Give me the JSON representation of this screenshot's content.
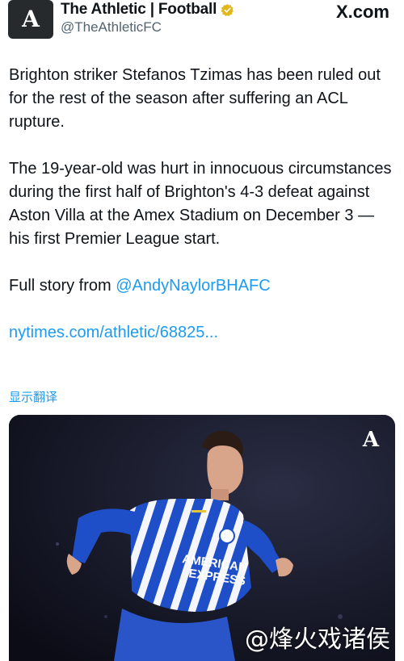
{
  "tweet": {
    "author": {
      "display_name": "The Athletic | Football",
      "handle": "@TheAthleticFC",
      "avatar_letter": "A",
      "verified_color": "#e2b719"
    },
    "site_badge": "X.com",
    "paragraphs": [
      "Brighton striker Stefanos Tzimas has been ruled out for the rest of the season after suffering an ACL rupture.",
      "The 19-year-old was hurt in innocuous circumstances during the first half of Brighton's 4-3 defeat against Aston Villa at the Amex Stadium on December 3 — his first Premier League start."
    ],
    "full_story_prefix": "Full story from ",
    "mention": "@AndyNaylorBHAFC",
    "link": "nytimes.com/athletic/68825...",
    "translate_label": "显示翻译",
    "media": {
      "logo_letter": "A",
      "jersey_sponsor_line1": "AMERICAN",
      "jersey_sponsor_line2": "EXPRESS",
      "kit_colors": [
        "#1f4fc8",
        "#ffffff"
      ]
    },
    "watermark": "@烽火戏诸侯",
    "link_color": "#1d9bf0"
  }
}
